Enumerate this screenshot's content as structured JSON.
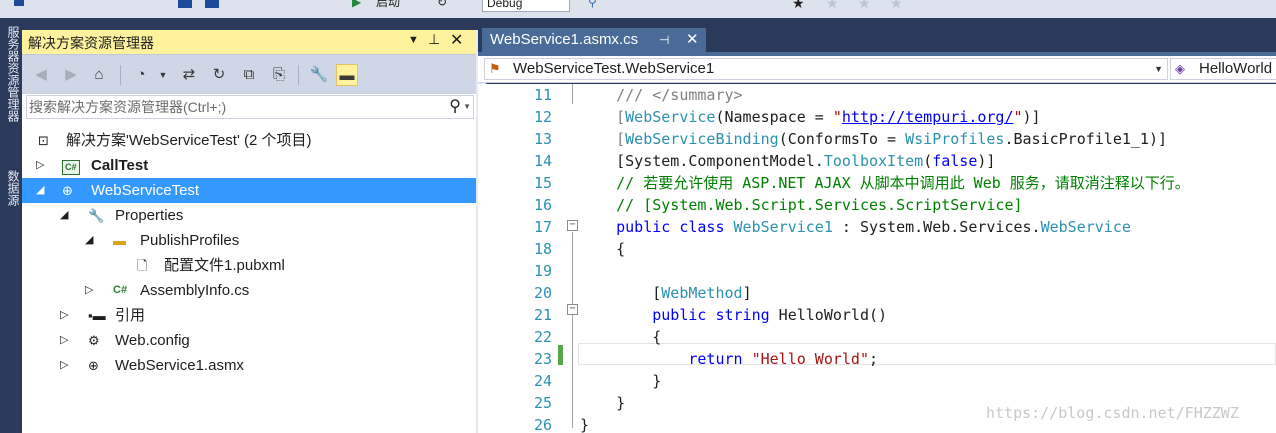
{
  "toolbar": {
    "start_label": "启动",
    "config_value": "Debug"
  },
  "vertical_tabs": [
    "服务器资源管理器",
    "数据源"
  ],
  "solution_explorer": {
    "title": "解决方案资源管理器",
    "pin_icon": "pin-icon",
    "close_icon": "close-icon",
    "search_placeholder": "搜索解决方案资源管理器(Ctrl+;)",
    "tree": [
      {
        "label": "解决方案'WebServiceTest' (2 个项目)",
        "depth": 0,
        "icon": "solution-icon",
        "expander": ""
      },
      {
        "label": "CallTest",
        "depth": 0,
        "icon": "csharp-project-icon",
        "expander": "collapsed",
        "bold": true
      },
      {
        "label": "WebServiceTest",
        "depth": 0,
        "icon": "web-project-icon",
        "expander": "expanded",
        "selected": true
      },
      {
        "label": "Properties",
        "depth": 1,
        "icon": "wrench-icon",
        "expander": "expanded"
      },
      {
        "label": "PublishProfiles",
        "depth": 2,
        "icon": "folder-icon",
        "expander": "expanded"
      },
      {
        "label": "配置文件1.pubxml",
        "depth": 3,
        "icon": "file-icon",
        "expander": ""
      },
      {
        "label": "AssemblyInfo.cs",
        "depth": 2,
        "icon": "csharp-file-icon",
        "expander": "collapsed"
      },
      {
        "label": "引用",
        "depth": 1,
        "icon": "references-icon",
        "expander": "collapsed"
      },
      {
        "label": "Web.config",
        "depth": 1,
        "icon": "config-icon",
        "expander": "collapsed"
      },
      {
        "label": "WebService1.asmx",
        "depth": 1,
        "icon": "web-file-icon",
        "expander": "collapsed"
      }
    ]
  },
  "editor": {
    "tab_label": "WebService1.asmx.cs",
    "nav_left": "WebServiceTest.WebService1",
    "nav_right": "HelloWorld",
    "line_numbers": [
      "11",
      "12",
      "13",
      "14",
      "15",
      "16",
      "17",
      "18",
      "19",
      "20",
      "21",
      "22",
      "23",
      "24",
      "25",
      "26"
    ],
    "watermark": "https://blog.csdn.net/FHZZWZ"
  }
}
